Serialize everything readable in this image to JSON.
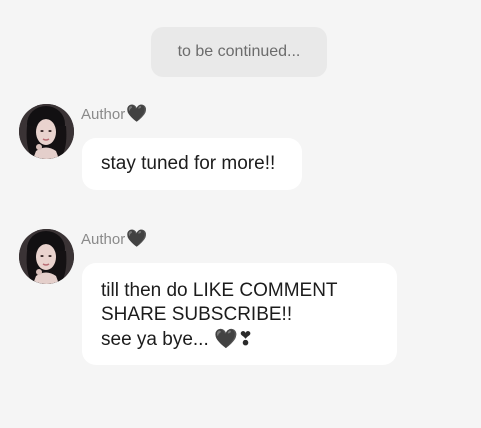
{
  "system_message": "to be continued...",
  "messages": [
    {
      "sender": "Author",
      "sender_badge": "🖤",
      "avatar_icon": "author-avatar",
      "lines": [
        "stay tuned for more!!"
      ]
    },
    {
      "sender": "Author",
      "sender_badge": "🖤",
      "avatar_icon": "author-avatar",
      "lines": [
        "till then do LIKE COMMENT",
        "SHARE SUBSCRIBE!!",
        "see ya bye..."
      ],
      "trailing_emoji": "🖤❣"
    }
  ],
  "colors": {
    "background": "#f5f5f5",
    "system_pill": "#e9e9e9",
    "bubble": "#ffffff",
    "sender_text": "#8a8a8a",
    "message_text": "#1c1c1c"
  }
}
